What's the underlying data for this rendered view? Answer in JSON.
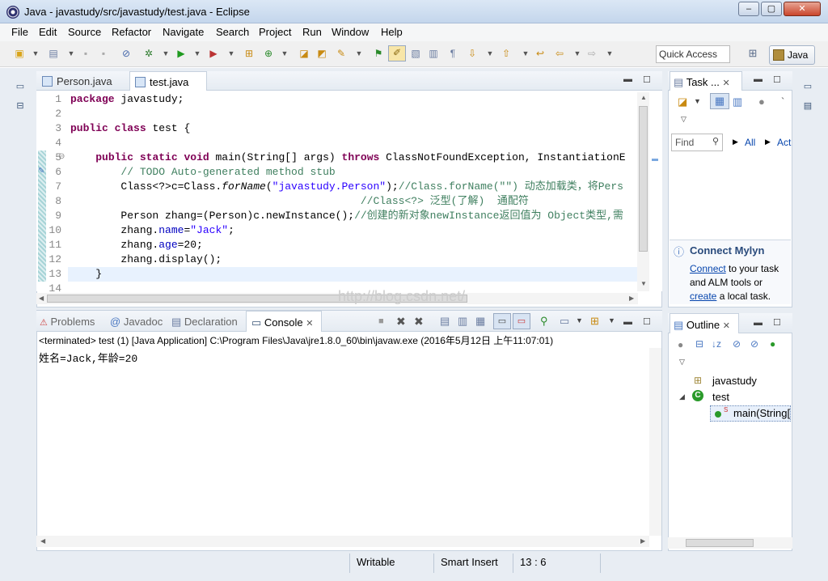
{
  "window": {
    "title": "Java - javastudy/src/javastudy/test.java - Eclipse",
    "min": "–",
    "max": "▢",
    "close": "✕"
  },
  "menu": [
    "File",
    "Edit",
    "Source",
    "Refactor",
    "Navigate",
    "Search",
    "Project",
    "Run",
    "Window",
    "Help"
  ],
  "toolbar": {
    "quick_access": "Quick Access",
    "perspective": "Java"
  },
  "editor": {
    "tabs": [
      {
        "label": "Person.java",
        "active": false
      },
      {
        "label": "test.java",
        "active": true
      }
    ],
    "line_numbers": [
      "1",
      "2",
      "3",
      "4",
      "5",
      "6",
      "7",
      "8",
      "9",
      "10",
      "11",
      "12",
      "13",
      "14"
    ],
    "lines": [
      {
        "n": 1,
        "parts": [
          [
            "kw",
            "package"
          ],
          [
            "p",
            " javastudy;"
          ]
        ]
      },
      {
        "n": 2,
        "parts": []
      },
      {
        "n": 3,
        "parts": [
          [
            "kw",
            "public"
          ],
          [
            "p",
            " "
          ],
          [
            "kw",
            "class"
          ],
          [
            "p",
            " test {"
          ]
        ]
      },
      {
        "n": 4,
        "parts": []
      },
      {
        "n": 5,
        "parts": [
          [
            "p",
            "    "
          ],
          [
            "kw",
            "public"
          ],
          [
            "p",
            " "
          ],
          [
            "kw",
            "static"
          ],
          [
            "p",
            " "
          ],
          [
            "kw",
            "void"
          ],
          [
            "p",
            " main(String[] args) "
          ],
          [
            "kw",
            "throws"
          ],
          [
            "p",
            " ClassNotFoundException, InstantiationE"
          ]
        ]
      },
      {
        "n": 6,
        "parts": [
          [
            "p",
            "        "
          ],
          [
            "cm",
            "// TODO Auto-generated method stub"
          ]
        ]
      },
      {
        "n": 7,
        "parts": [
          [
            "p",
            "        Class<?>c=Class."
          ],
          [
            "ital",
            "forName"
          ],
          [
            "p",
            "("
          ],
          [
            "str",
            "\"javastudy.Person\""
          ],
          [
            "p",
            ");"
          ],
          [
            "cm",
            "//Class.forName(\"\") 动态加载类，将Pers"
          ]
        ]
      },
      {
        "n": 8,
        "parts": [
          [
            "p",
            "                                              "
          ],
          [
            "cm",
            "//Class<?> 泛型(了解)  通配符"
          ]
        ]
      },
      {
        "n": 9,
        "parts": [
          [
            "p",
            "        Person zhang=(Person)c.newInstance();"
          ],
          [
            "cm",
            "//创建的新对象newInstance返回值为 Object类型,需"
          ]
        ]
      },
      {
        "n": 10,
        "parts": [
          [
            "p",
            "        zhang."
          ],
          [
            "fld",
            "name"
          ],
          [
            "p",
            "="
          ],
          [
            "str",
            "\"Jack\""
          ],
          [
            "p",
            ";"
          ]
        ]
      },
      {
        "n": 11,
        "parts": [
          [
            "p",
            "        zhang."
          ],
          [
            "fld",
            "age"
          ],
          [
            "p",
            "=20;"
          ]
        ]
      },
      {
        "n": 12,
        "parts": [
          [
            "p",
            "        zhang.display();"
          ]
        ]
      },
      {
        "n": 13,
        "parts": [
          [
            "p",
            "    }"
          ]
        ]
      },
      {
        "n": 14,
        "parts": []
      }
    ]
  },
  "console": {
    "tabs": [
      "Problems",
      "Javadoc",
      "Declaration",
      "Console"
    ],
    "active_tab": "Console",
    "status": "<terminated> test (1) [Java Application] C:\\Program Files\\Java\\jre1.8.0_60\\bin\\javaw.exe (2016年5月12日 上午11:07:01)",
    "output": "姓名=Jack,年龄=20"
  },
  "task": {
    "tab": "Task ...",
    "find_placeholder": "Find",
    "all": "All",
    "act": "Act",
    "connect_title": "Connect Mylyn",
    "connect_link": "Connect",
    "connect_text1": " to your task",
    "connect_text2": "and ALM tools or",
    "create_link": "create",
    "connect_text3": " a local task."
  },
  "outline": {
    "tab": "Outline",
    "package": "javastudy",
    "class": "test",
    "method": "main(String["
  },
  "status": {
    "writable": "Writable",
    "insert": "Smart Insert",
    "position": "13 : 6"
  },
  "watermark": "http://blog.csdn.net/"
}
